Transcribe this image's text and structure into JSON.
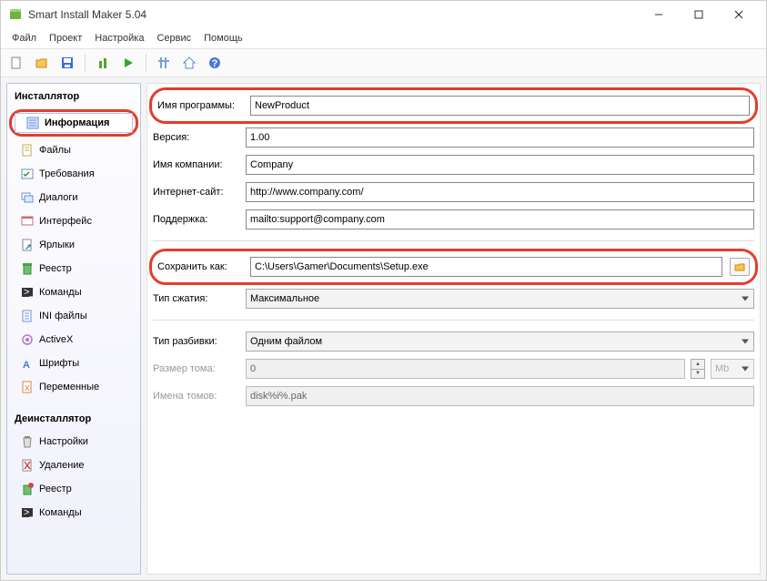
{
  "window": {
    "title": "Smart Install Maker 5.04"
  },
  "menu": {
    "file": "Файл",
    "project": "Проект",
    "settings": "Настройка",
    "service": "Сервис",
    "help": "Помощь"
  },
  "sidebar": {
    "installer_title": "Инсталлятор",
    "uninstaller_title": "Деинсталлятор",
    "installer_items": [
      "Информация",
      "Файлы",
      "Требования",
      "Диалоги",
      "Интерфейс",
      "Ярлыки",
      "Реестр",
      "Команды",
      "INI файлы",
      "ActiveX",
      "Шрифты",
      "Переменные"
    ],
    "uninstaller_items": [
      "Настройки",
      "Удаление",
      "Реестр",
      "Команды"
    ]
  },
  "form": {
    "labels": {
      "program_name": "Имя программы:",
      "version": "Версия:",
      "company": "Имя компании:",
      "website": "Интернет-сайт:",
      "support": "Поддержка:",
      "save_as": "Сохранить как:",
      "compression": "Тип сжатия:",
      "split": "Тип разбивки:",
      "volume_size": "Размер тома:",
      "volume_names": "Имена томов:"
    },
    "values": {
      "program_name": "NewProduct",
      "version": "1.00",
      "company": "Company",
      "website": "http://www.company.com/",
      "support": "mailto:support@company.com",
      "save_as": "C:\\Users\\Gamer\\Documents\\Setup.exe",
      "compression": "Максимальное",
      "split": "Одним файлом",
      "volume_size": "0",
      "volume_unit": "Mb",
      "volume_names": "disk%i%.pak"
    }
  }
}
